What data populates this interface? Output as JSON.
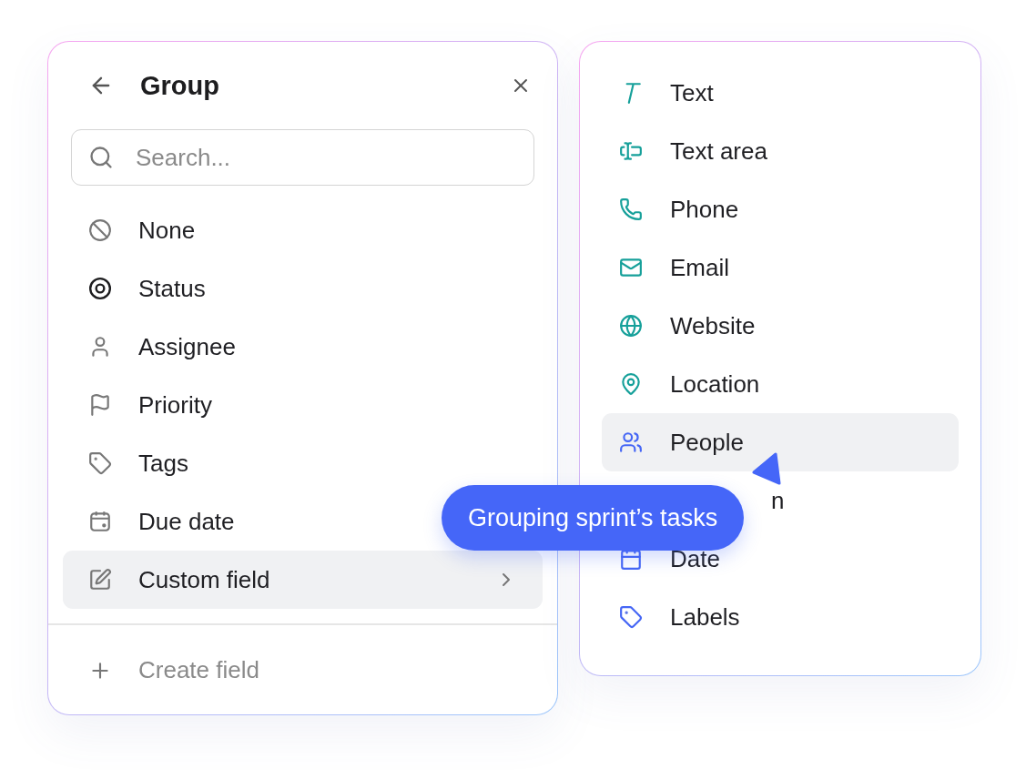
{
  "group_panel": {
    "title": "Group",
    "search": {
      "placeholder": "Search..."
    },
    "items": [
      {
        "label": "None",
        "selected": false,
        "kind": "plain"
      },
      {
        "label": "Status",
        "selected": false,
        "kind": "plain"
      },
      {
        "label": "Assignee",
        "selected": false,
        "kind": "plain"
      },
      {
        "label": "Priority",
        "selected": false,
        "kind": "plain"
      },
      {
        "label": "Tags",
        "selected": false,
        "kind": "plain"
      },
      {
        "label": "Due date",
        "selected": false,
        "kind": "plain"
      },
      {
        "label": "Custom field",
        "selected": true,
        "kind": "submenu"
      }
    ],
    "create_action": "Create field"
  },
  "field_types": [
    {
      "label": "Text",
      "selected": false,
      "kind": "plain",
      "color": "#16a09a"
    },
    {
      "label": "Text area",
      "selected": false,
      "kind": "plain",
      "color": "#16a09a"
    },
    {
      "label": "Phone",
      "selected": false,
      "kind": "plain",
      "color": "#16a09a"
    },
    {
      "label": "Email",
      "selected": false,
      "kind": "plain",
      "color": "#16a09a"
    },
    {
      "label": "Website",
      "selected": false,
      "kind": "plain",
      "color": "#16a09a"
    },
    {
      "label": "Location",
      "selected": false,
      "kind": "plain",
      "color": "#16a09a"
    },
    {
      "label": "People",
      "selected": true,
      "kind": "plain",
      "color": "#4566f5"
    },
    {
      "label": "n",
      "selected": false,
      "kind": "covered"
    },
    {
      "label": "Date",
      "selected": false,
      "kind": "plain",
      "color": "#4566f5"
    },
    {
      "label": "Labels",
      "selected": false,
      "kind": "plain",
      "color": "#4566f5"
    }
  ],
  "tooltip": "Grouping sprint’s tasks"
}
